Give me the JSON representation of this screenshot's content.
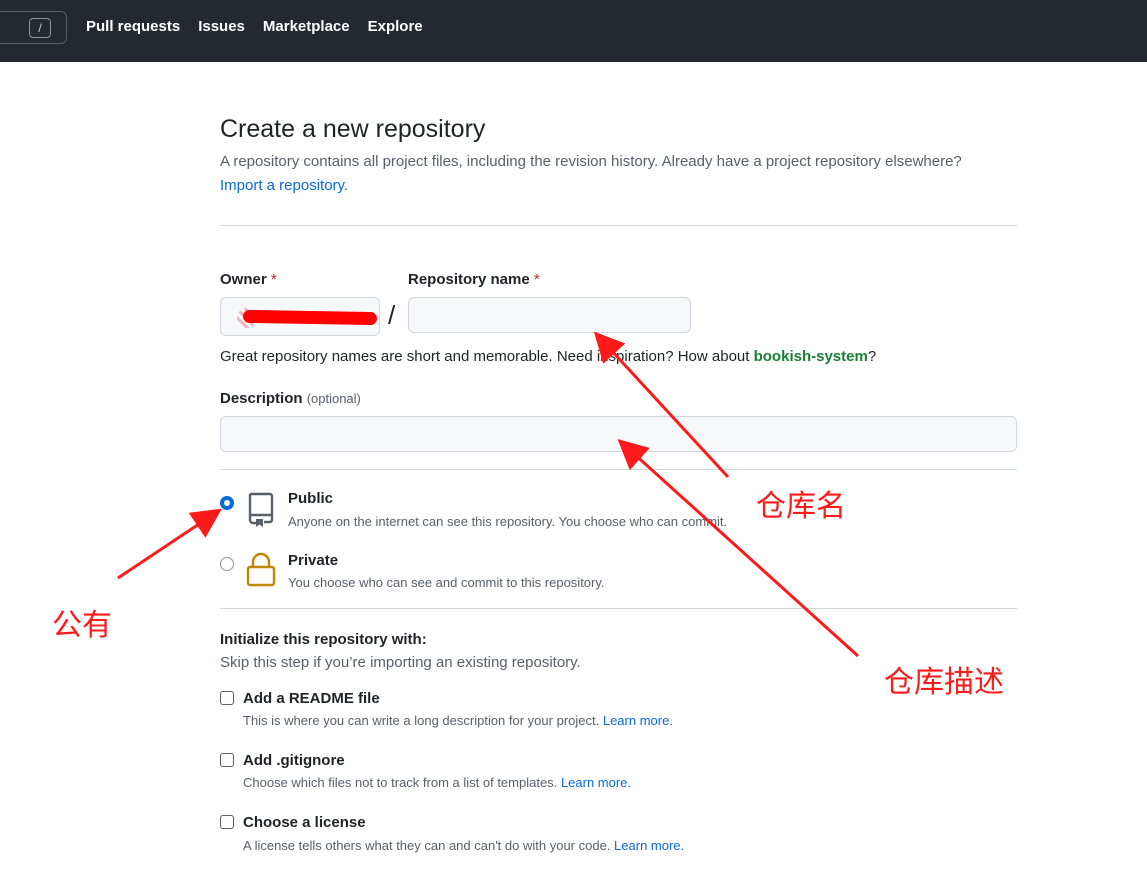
{
  "header": {
    "search_shortcut": "/",
    "nav": [
      "Pull requests",
      "Issues",
      "Marketplace",
      "Explore"
    ]
  },
  "page": {
    "title": "Create a new repository",
    "subtitle": "A repository contains all project files, including the revision history. Already have a project repository elsewhere?",
    "import_link": "Import a repository."
  },
  "form": {
    "owner_label": "Owner",
    "repo_label": "Repository name",
    "required_mark": "*",
    "slash": "/",
    "repo_name_value": "",
    "hint_prefix": "Great repository names are short and memorable. Need inspiration? How about ",
    "hint_suggestion": "bookish-system",
    "hint_suffix": "?",
    "description_label": "Description",
    "description_optional": "(optional)",
    "description_value": ""
  },
  "visibility": {
    "selected": "Public",
    "options": [
      {
        "title": "Public",
        "desc": "Anyone on the internet can see this repository. You choose who can commit."
      },
      {
        "title": "Private",
        "desc": "You choose who can see and commit to this repository."
      }
    ]
  },
  "init": {
    "title": "Initialize this repository with:",
    "subtitle": "Skip this step if you’re importing an existing repository.",
    "learn_more": "Learn more.",
    "options": [
      {
        "title": "Add a README file",
        "desc": "This is where you can write a long description for your project."
      },
      {
        "title": "Add .gitignore",
        "desc": "Choose which files not to track from a list of templates."
      },
      {
        "title": "Choose a license",
        "desc": "A license tells others what they can and can't do with your code."
      }
    ]
  },
  "annotations": {
    "repo_name": "仓库名",
    "public": "公有",
    "description": "仓库描述"
  },
  "colors": {
    "header_bg": "#24292f",
    "link": "#0969da",
    "suggestion": "#1a7f37",
    "required": "#cf222e",
    "annotation": "#ff1a1a",
    "private_lock": "#bf8700"
  }
}
